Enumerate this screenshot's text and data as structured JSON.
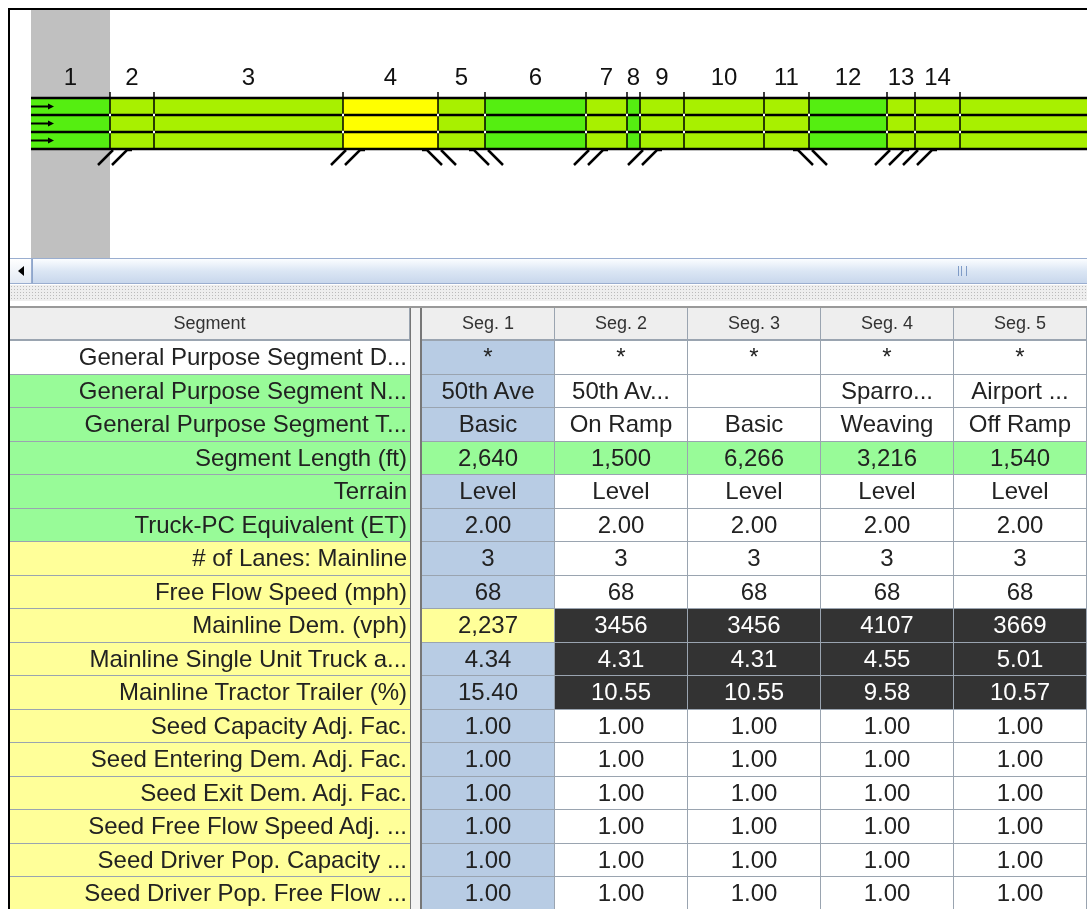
{
  "diagram": {
    "segments": [
      {
        "label": "1",
        "color": "#55ee11",
        "selected": true,
        "on_ramp": false,
        "off_ramp": false
      },
      {
        "label": "2",
        "color": "#a8f000",
        "selected": false,
        "on_ramp": true,
        "off_ramp": false
      },
      {
        "label": "3",
        "color": "#a8f000",
        "selected": false,
        "on_ramp": false,
        "off_ramp": false
      },
      {
        "label": "4",
        "color": "#ffff00",
        "selected": false,
        "on_ramp": true,
        "off_ramp": true
      },
      {
        "label": "5",
        "color": "#a8f000",
        "selected": false,
        "on_ramp": false,
        "off_ramp": true
      },
      {
        "label": "6",
        "color": "#55ee11",
        "selected": false,
        "on_ramp": false,
        "off_ramp": false
      },
      {
        "label": "7",
        "color": "#a8f000",
        "selected": false,
        "on_ramp": true,
        "off_ramp": false
      },
      {
        "label": "8",
        "color": "#55ee11",
        "selected": false,
        "on_ramp": false,
        "off_ramp": false
      },
      {
        "label": "9",
        "color": "#a8f000",
        "selected": false,
        "on_ramp": true,
        "off_ramp": false
      },
      {
        "label": "10",
        "color": "#a8f000",
        "selected": false,
        "on_ramp": false,
        "off_ramp": false
      },
      {
        "label": "11",
        "color": "#a8f000",
        "selected": false,
        "on_ramp": false,
        "off_ramp": true
      },
      {
        "label": "12",
        "color": "#55ee11",
        "selected": false,
        "on_ramp": false,
        "off_ramp": false
      },
      {
        "label": "13",
        "color": "#a8f000",
        "selected": false,
        "on_ramp": true,
        "off_ramp": false
      },
      {
        "label": "14",
        "color": "#a8f000",
        "selected": false,
        "on_ramp": true,
        "off_ramp": false
      },
      {
        "color": "#a8f000",
        "selected": false,
        "on_ramp": false,
        "off_ramp": false
      }
    ]
  },
  "table": {
    "corner": "Segment",
    "columns": [
      "Seg. 1",
      "Seg. 2",
      "Seg. 3",
      "Seg. 4",
      "Seg. 5"
    ],
    "rows": [
      {
        "label": "General Purpose Segment D...",
        "color": "#ffffff",
        "cells": [
          {
            "text": "*",
            "color": "#b8cce4"
          },
          {
            "text": "*",
            "color": "#ffffff"
          },
          {
            "text": "*",
            "color": "#ffffff"
          },
          {
            "text": "*",
            "color": "#ffffff"
          },
          {
            "text": "*",
            "color": "#ffffff"
          }
        ]
      },
      {
        "label": "General Purpose Segment N...",
        "color": "#98fb98",
        "cells": [
          {
            "text": "50th Ave",
            "color": "#b8cce4"
          },
          {
            "text": "50th Av...",
            "color": "#ffffff"
          },
          {
            "color": "#ffffff"
          },
          {
            "text": "Sparro...",
            "color": "#ffffff"
          },
          {
            "text": "Airport ...",
            "color": "#ffffff"
          }
        ]
      },
      {
        "label": "General Purpose Segment T...",
        "color": "#98fb98",
        "cells": [
          {
            "text": "Basic",
            "color": "#b8cce4"
          },
          {
            "text": "On Ramp",
            "color": "#ffffff"
          },
          {
            "text": "Basic",
            "color": "#ffffff"
          },
          {
            "text": "Weaving",
            "color": "#ffffff"
          },
          {
            "text": "Off Ramp",
            "color": "#ffffff"
          }
        ]
      },
      {
        "label": "Segment Length (ft)",
        "color": "#98fb98",
        "cells": [
          {
            "text": "2,640",
            "color": "#98fb98"
          },
          {
            "text": "1,500",
            "color": "#98fb98"
          },
          {
            "text": "6,266",
            "color": "#98fb98"
          },
          {
            "text": "3,216",
            "color": "#98fb98"
          },
          {
            "text": "1,540",
            "color": "#98fb98"
          }
        ]
      },
      {
        "label": "Terrain",
        "color": "#98fb98",
        "cells": [
          {
            "text": "Level",
            "color": "#b8cce4"
          },
          {
            "text": "Level",
            "color": "#ffffff"
          },
          {
            "text": "Level",
            "color": "#ffffff"
          },
          {
            "text": "Level",
            "color": "#ffffff"
          },
          {
            "text": "Level",
            "color": "#ffffff"
          }
        ]
      },
      {
        "label": "Truck-PC Equivalent (ET)",
        "color": "#98fb98",
        "cells": [
          {
            "text": "2.00",
            "color": "#b8cce4"
          },
          {
            "text": "2.00",
            "color": "#ffffff"
          },
          {
            "text": "2.00",
            "color": "#ffffff"
          },
          {
            "text": "2.00",
            "color": "#ffffff"
          },
          {
            "text": "2.00",
            "color": "#ffffff"
          }
        ]
      },
      {
        "label": "# of Lanes: Mainline",
        "color": "#ffff99",
        "cells": [
          {
            "text": "3",
            "color": "#b8cce4"
          },
          {
            "text": "3",
            "color": "#ffffff"
          },
          {
            "text": "3",
            "color": "#ffffff"
          },
          {
            "text": "3",
            "color": "#ffffff"
          },
          {
            "text": "3",
            "color": "#ffffff"
          }
        ]
      },
      {
        "label": "Free Flow Speed (mph)",
        "color": "#ffff99",
        "cells": [
          {
            "text": "68",
            "color": "#b8cce4"
          },
          {
            "text": "68",
            "color": "#ffffff"
          },
          {
            "text": "68",
            "color": "#ffffff"
          },
          {
            "text": "68",
            "color": "#ffffff"
          },
          {
            "text": "68",
            "color": "#ffffff"
          }
        ]
      },
      {
        "label": "Mainline Dem. (vph)",
        "color": "#ffff99",
        "cells": [
          {
            "text": "2,237",
            "color": "#ffff99"
          },
          {
            "text": "3456",
            "color": "#333333"
          },
          {
            "text": "3456",
            "color": "#333333"
          },
          {
            "text": "4107",
            "color": "#333333"
          },
          {
            "text": "3669",
            "color": "#333333"
          }
        ]
      },
      {
        "label": "Mainline Single Unit Truck a...",
        "color": "#ffff99",
        "cells": [
          {
            "text": "4.34",
            "color": "#b8cce4"
          },
          {
            "text": "4.31",
            "color": "#333333"
          },
          {
            "text": "4.31",
            "color": "#333333"
          },
          {
            "text": "4.55",
            "color": "#333333"
          },
          {
            "text": "5.01",
            "color": "#333333"
          }
        ]
      },
      {
        "label": "Mainline Tractor Trailer (%)",
        "color": "#ffff99",
        "cells": [
          {
            "text": "15.40",
            "color": "#b8cce4"
          },
          {
            "text": "10.55",
            "color": "#333333"
          },
          {
            "text": "10.55",
            "color": "#333333"
          },
          {
            "text": "9.58",
            "color": "#333333"
          },
          {
            "text": "10.57",
            "color": "#333333"
          }
        ]
      },
      {
        "label": "Seed Capacity Adj. Fac.",
        "color": "#ffff99",
        "cells": [
          {
            "text": "1.00",
            "color": "#b8cce4"
          },
          {
            "text": "1.00",
            "color": "#ffffff"
          },
          {
            "text": "1.00",
            "color": "#ffffff"
          },
          {
            "text": "1.00",
            "color": "#ffffff"
          },
          {
            "text": "1.00",
            "color": "#ffffff"
          }
        ]
      },
      {
        "label": "Seed Entering Dem. Adj. Fac.",
        "color": "#ffff99",
        "cells": [
          {
            "text": "1.00",
            "color": "#b8cce4"
          },
          {
            "text": "1.00",
            "color": "#ffffff"
          },
          {
            "text": "1.00",
            "color": "#ffffff"
          },
          {
            "text": "1.00",
            "color": "#ffffff"
          },
          {
            "text": "1.00",
            "color": "#ffffff"
          }
        ]
      },
      {
        "label": "Seed Exit Dem. Adj. Fac.",
        "color": "#ffff99",
        "cells": [
          {
            "text": "1.00",
            "color": "#b8cce4"
          },
          {
            "text": "1.00",
            "color": "#ffffff"
          },
          {
            "text": "1.00",
            "color": "#ffffff"
          },
          {
            "text": "1.00",
            "color": "#ffffff"
          },
          {
            "text": "1.00",
            "color": "#ffffff"
          }
        ]
      },
      {
        "label": "Seed Free Flow Speed Adj. ...",
        "color": "#ffff99",
        "cells": [
          {
            "text": "1.00",
            "color": "#b8cce4"
          },
          {
            "text": "1.00",
            "color": "#ffffff"
          },
          {
            "text": "1.00",
            "color": "#ffffff"
          },
          {
            "text": "1.00",
            "color": "#ffffff"
          },
          {
            "text": "1.00",
            "color": "#ffffff"
          }
        ]
      },
      {
        "label": "Seed Driver Pop. Capacity ...",
        "color": "#ffff99",
        "cells": [
          {
            "text": "1.00",
            "color": "#b8cce4"
          },
          {
            "text": "1.00",
            "color": "#ffffff"
          },
          {
            "text": "1.00",
            "color": "#ffffff"
          },
          {
            "text": "1.00",
            "color": "#ffffff"
          },
          {
            "text": "1.00",
            "color": "#ffffff"
          }
        ]
      },
      {
        "label": "Seed Driver Pop. Free Flow ...",
        "color": "#ffff99",
        "cells": [
          {
            "text": "1.00",
            "color": "#b8cce4"
          },
          {
            "text": "1.00",
            "color": "#ffffff"
          },
          {
            "text": "1.00",
            "color": "#ffffff"
          },
          {
            "text": "1.00",
            "color": "#ffffff"
          },
          {
            "text": "1.00",
            "color": "#ffffff"
          }
        ]
      }
    ]
  }
}
